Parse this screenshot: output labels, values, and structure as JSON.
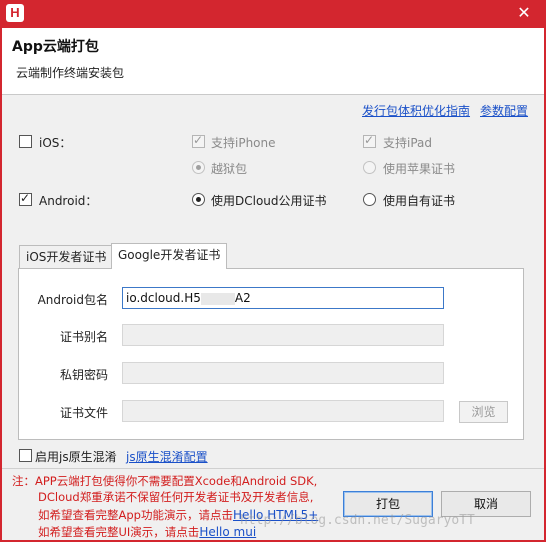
{
  "window": {
    "app_icon": "H",
    "close": "✕"
  },
  "header": {
    "title": "App云端打包",
    "subtitle": "云端制作终端安装包"
  },
  "links": {
    "optimize_guide": "发行包体积优化指南",
    "param_config": "参数配置"
  },
  "ios": {
    "label": "iOS：",
    "checked": false,
    "support_iphone": "支持iPhone",
    "support_ipad": "支持iPad",
    "jailbreak": "越狱包",
    "apple_cert": "使用苹果证书"
  },
  "android": {
    "label": "Android：",
    "checked": true,
    "dcloud_cert": "使用DCloud公用证书",
    "own_cert": "使用自有证书"
  },
  "tabs": [
    {
      "label": "iOS开发者证书",
      "active": false
    },
    {
      "label": "Google开发者证书",
      "active": true
    }
  ],
  "form": {
    "package_label": "Android包名",
    "package_value_prefix": "io.dcloud.H5",
    "package_value_suffix": "A2",
    "alias_label": "证书别名",
    "password_label": "私钥密码",
    "file_label": "证书文件",
    "browse_label": "浏览"
  },
  "obfuscate": {
    "label": "启用js原生混淆",
    "link": "js原生混淆配置",
    "checked": false
  },
  "notes": {
    "line1": "注：APP云端打包使得你不需要配置Xcode和Android SDK,",
    "line2": "DCloud郑重承诺不保留任何开发者证书及开发者信息,",
    "line3_prefix": "如希望查看完整App功能演示，请点击",
    "line3_link": "Hello HTML5+",
    "line4_prefix": "如希望查看完整UI演示，请点击",
    "line4_link": "Hello mui"
  },
  "buttons": {
    "pack": "打包",
    "cancel": "取消"
  },
  "watermark": "http://blog.csdn.net/SugaryoTT",
  "colors": {
    "accent": "#d3262f",
    "link": "#1a50c8",
    "note": "#d21e1e"
  }
}
